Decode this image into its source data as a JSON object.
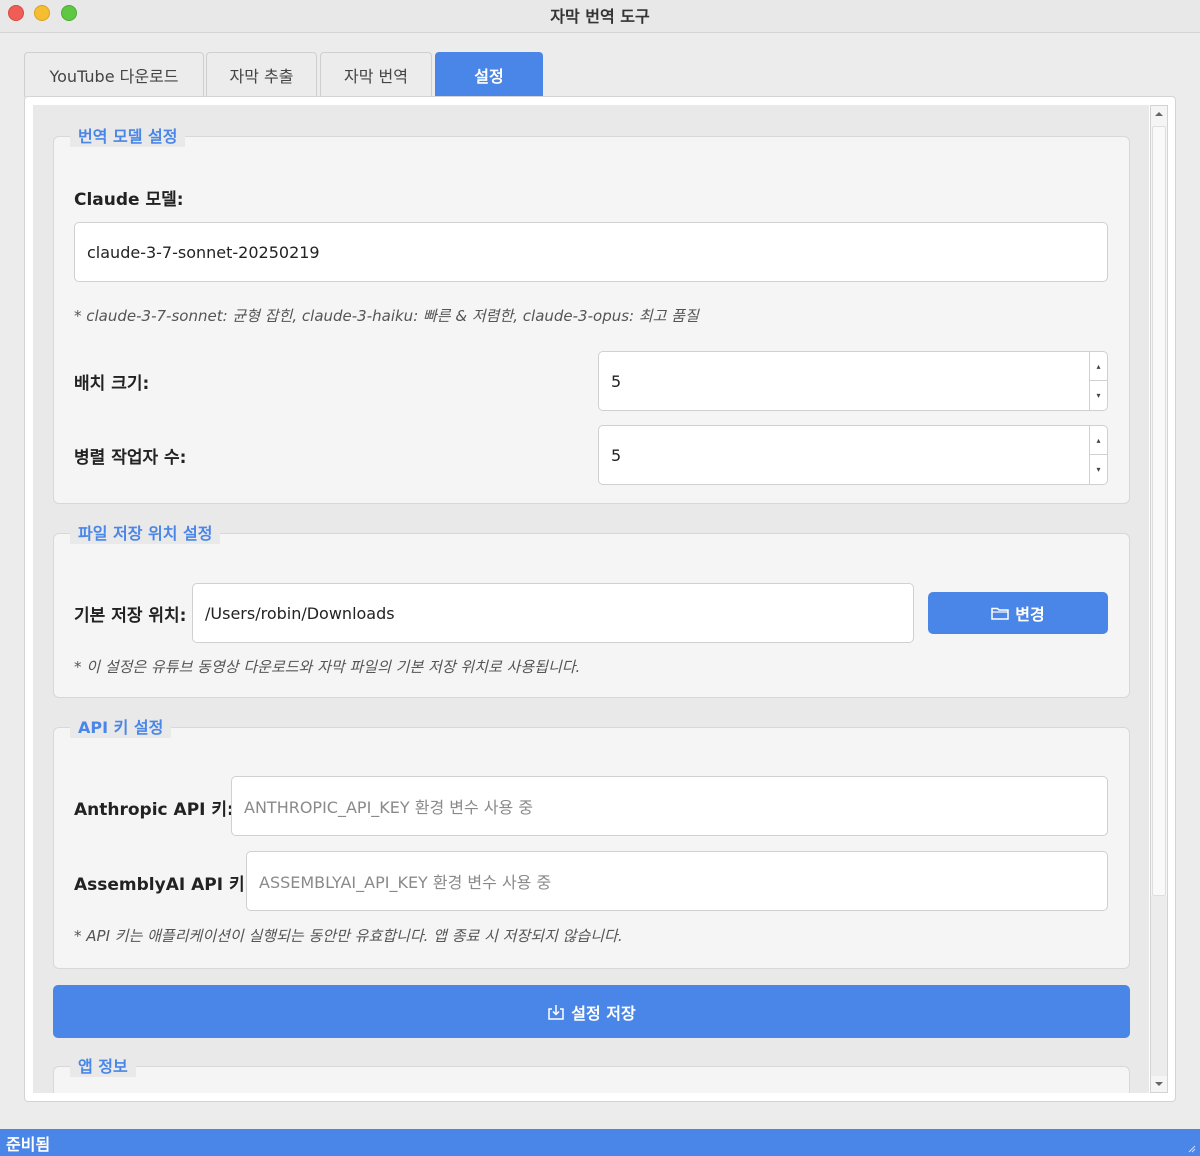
{
  "window": {
    "title": "자막 번역 도구"
  },
  "tabs": [
    {
      "label": "YouTube 다운로드"
    },
    {
      "label": "자막 추출"
    },
    {
      "label": "자막 번역"
    },
    {
      "label": "설정",
      "active": true
    }
  ],
  "model_group": {
    "title": "번역 모델 설정",
    "claude_label": "Claude 모델:",
    "claude_value": "claude-3-7-sonnet-20250219",
    "hint": "* claude-3-7-sonnet: 균형 잡힌, claude-3-haiku: 빠른 & 저렴한, claude-3-opus: 최고 품질",
    "batch_label": "배치 크기:",
    "batch_value": "5",
    "workers_label": "병렬 작업자 수:",
    "workers_value": "5"
  },
  "storage_group": {
    "title": "파일 저장 위치 설정",
    "path_label": "기본 저장 위치:",
    "path_value": "/Users/robin/Downloads",
    "change_button": "변경",
    "hint": "* 이 설정은 유튜브 동영상 다운로드와 자막 파일의 기본 저장 위치로 사용됩니다."
  },
  "api_group": {
    "title": "API 키 설정",
    "anthropic_label": "Anthropic API 키:",
    "anthropic_placeholder": "ANTHROPIC_API_KEY 환경 변수 사용 중",
    "assembly_label": "AssemblyAI API 키:",
    "assembly_placeholder": "ASSEMBLYAI_API_KEY 환경 변수 사용 중",
    "hint": "* API 키는 애플리케이션이 실행되는 동안만 유효합니다. 앱 종료 시 저장되지 않습니다."
  },
  "save_button": "설정 저장",
  "app_info_group": {
    "title": "앱 정보"
  },
  "status": {
    "text": "준비됨"
  },
  "colors": {
    "accent": "#4a86e8",
    "background": "#ececec"
  }
}
